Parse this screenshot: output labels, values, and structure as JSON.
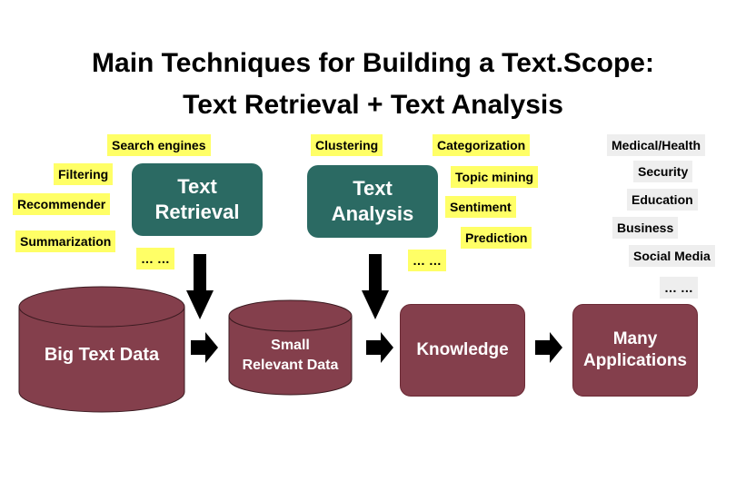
{
  "title": {
    "line1": "Main Techniques for Building a Text.Scope:",
    "line2": "Text Retrieval + Text Analysis"
  },
  "retrieval": {
    "label_line1": "Text",
    "label_line2": "Retrieval",
    "techniques": [
      "Search engines",
      "Filtering",
      "Recommender",
      "Summarization",
      "… …"
    ]
  },
  "analysis": {
    "label_line1": "Text",
    "label_line2": "Analysis",
    "techniques": [
      "Clustering",
      "Categorization",
      "Topic mining",
      "Sentiment",
      "Prediction",
      "… …"
    ]
  },
  "applications": [
    "Medical/Health",
    "Security",
    "Education",
    "Business",
    "Social Media",
    "… …"
  ],
  "pipeline": {
    "big_data": "Big Text Data",
    "small_data_line1": "Small",
    "small_data_line2": "Relevant Data",
    "knowledge": "Knowledge",
    "apps_line1": "Many",
    "apps_line2": "Applications"
  },
  "colors": {
    "technique_bg": "#ffff66",
    "application_bg": "#eeeeee",
    "process_box": "#2b6a63",
    "data_box": "#843f4c",
    "arrow": "#000000"
  }
}
